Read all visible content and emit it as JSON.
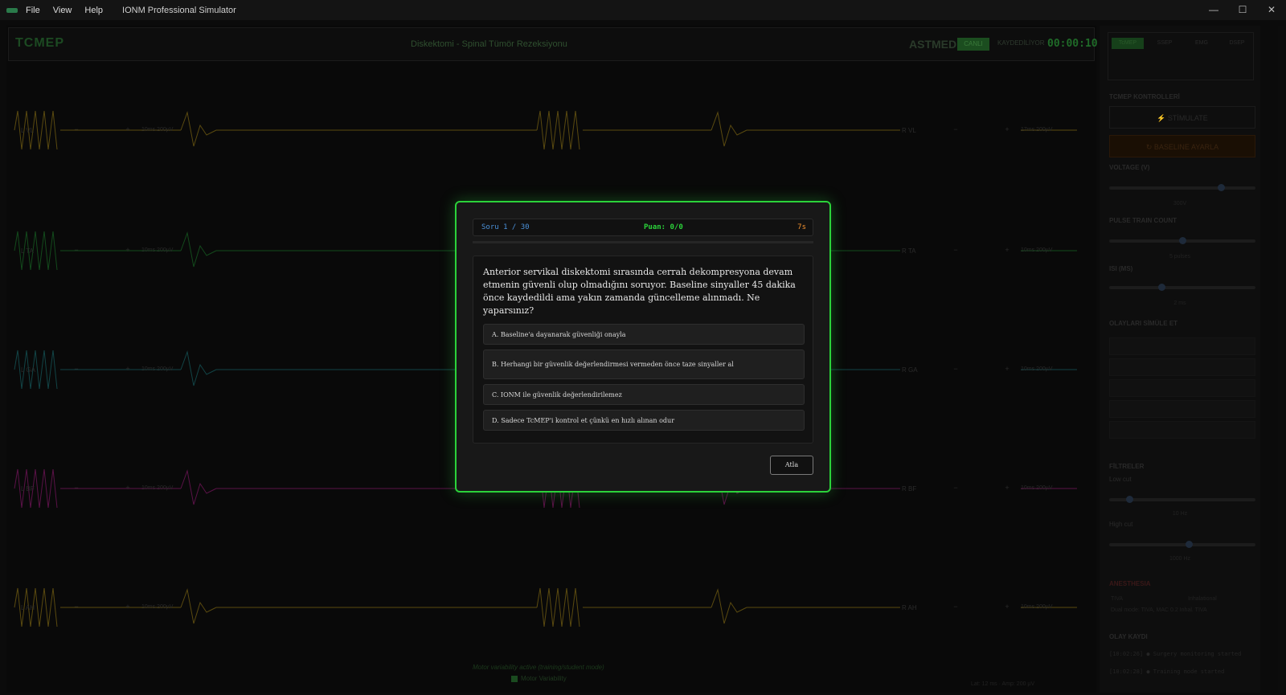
{
  "window": {
    "menus": [
      "File",
      "View",
      "Help"
    ],
    "title": "IONM Professional Simulator",
    "controls": [
      "—",
      "☐",
      "✕"
    ]
  },
  "header": {
    "logo": "TCMEP",
    "case": "Diskektomi - Spinal Tümör Rezeksiyonu",
    "brand": "ASTMED",
    "live": "CANLI",
    "rec": "KAYDEDİLİYOR",
    "timer": "00:00:10"
  },
  "traces": [
    {
      "left_label": "L VL",
      "left_info": "10ms 200µV",
      "right_label": "R VL",
      "right_info": "17ms 200µV",
      "color": "#5a4a10"
    },
    {
      "left_label": "L TA",
      "left_info": "10ms 200µV",
      "right_label": "R TA",
      "right_info": "10ms 200µV",
      "color": "#134a1c"
    },
    {
      "left_label": "L GA",
      "left_info": "10ms 200µV",
      "right_label": "R GA",
      "right_info": "10ms 200µV",
      "color": "#124446"
    },
    {
      "left_label": "L BF",
      "left_info": "10ms 200µV",
      "right_label": "R BF",
      "right_info": "10ms 200µV",
      "color": "#5a1247"
    },
    {
      "left_label": "L AH",
      "left_info": "10ms 200µV",
      "right_label": "R AH",
      "right_info": "10ms 200µV",
      "color": "#5a4a10"
    }
  ],
  "footer": {
    "note": "Motor variability active (training/student mode)",
    "checkbox_label": "Motor Variability",
    "stats": "Lat: 12 ms · Amp: 200 µV"
  },
  "sidebar": {
    "tabs": [
      "TcMEP",
      "SSEP",
      "EMG",
      "DSEP"
    ],
    "tcmep_controls_title": "TCMEP KONTROLLERİ",
    "stimulate": "⚡ STİMULATE",
    "baseline": "↻ BASELINE AYARLA",
    "voltage_label": "VOLTAGE (V)",
    "voltage_value": "300V",
    "voltage_level": 0.78,
    "pulse_label": "PULSE TRAIN COUNT",
    "pulse_value": "5 pulses",
    "pulse_level": 0.5,
    "isi_label": "ISI (MS)",
    "isi_value": "2 ms",
    "isi_level": 0.35,
    "events_label": "OLAYLARI SİMÜLE ET",
    "filters_label": "FİLTRELER",
    "lowcut_label": "Low cut",
    "lowcut_value": "10 Hz",
    "lowcut_level": 0.12,
    "highcut_label": "High cut",
    "highcut_value": "1000 Hz",
    "highcut_level": 0.55,
    "anesthesia_label": "ANESTHESIA",
    "anesth_opt1": "TIVA",
    "anesth_opt2": "Inhalational",
    "anesth_note": "Dual mode: TIVA, MAC 0.2 Inhal. TIVA",
    "log_label": "OLAY KAYDI",
    "log": [
      "[10:02:26] ● Surgery monitoring started",
      "[10:02:28] ● Training mode started"
    ]
  },
  "quiz": {
    "question_counter": "Soru 1 / 30",
    "score": "Puan: 0/0",
    "time_left": "7s",
    "progress": 0.0,
    "question": "Anterior servikal diskektomi sırasında cerrah dekompresyona devam etmenin güvenli olup olmadığını soruyor. Baseline sinyaller 45 dakika önce kaydedildi ama yakın zamanda güncelleme alınmadı. Ne yaparsınız?",
    "options": [
      "A. Baseline'a dayanarak güvenliği onayla",
      "B. Herhangi bir güvenlik değerlendirmesi vermeden önce taze sinyaller al",
      "C. IONM ile güvenlik değerlendirilemez",
      "D. Sadece TcMEP'i kontrol et çünkü en hızlı alınan odur"
    ],
    "skip": "Atla"
  }
}
